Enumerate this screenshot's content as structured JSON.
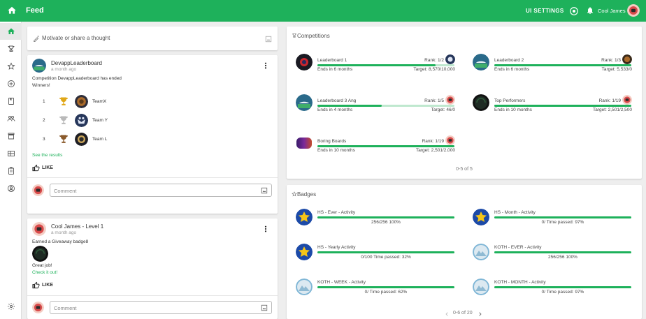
{
  "app": {
    "title": "Feed",
    "ui_settings": "UI SETTINGS",
    "user_name": "Cool James"
  },
  "colors": {
    "brand": "#1eb15b",
    "bar_track": "#bfe8cf"
  },
  "sidebar": {
    "icons": [
      "home-icon",
      "trophy-icon",
      "star-icon",
      "plus-circle-icon",
      "book-icon",
      "people-icon",
      "store-icon",
      "grid-icon",
      "assignment-icon",
      "account-icon",
      "settings-icon"
    ]
  },
  "composer": {
    "placeholder": "Motivate or share a thought"
  },
  "posts": [
    {
      "author": "DevappLeaderboard",
      "time": "a month ago",
      "text": "Competition DevappLeaderboard has ended",
      "text2": "Winners!",
      "winners": [
        {
          "place": "1",
          "team": "TeamX"
        },
        {
          "place": "2",
          "team": "Team Y"
        },
        {
          "place": "3",
          "team": "Team L"
        }
      ],
      "link": "See the results",
      "like": "LIKE",
      "comment_placeholder": "Comment"
    },
    {
      "author": "Cool James - Level 1",
      "time": "a month ago",
      "text": "Earned a Giveaway badge8",
      "text2": "Great job!",
      "link": "Check it out!",
      "like": "LIKE",
      "comment_placeholder": "Comment"
    }
  ],
  "competitions": {
    "title": "Competitions",
    "items": [
      {
        "name": "Leaderboard 1",
        "rank": "Rank: 1/2",
        "ends": "Ends in 6 months",
        "target": "Target: 8,570/10,000",
        "progress": 0.86
      },
      {
        "name": "Leaderboard 2",
        "rank": "Rank: 1/3",
        "ends": "Ends in 6 months",
        "target": "Target: 5,533/0",
        "progress": 1.0
      },
      {
        "name": "Leaderboard 3 Ang",
        "rank": "Rank: 1/5",
        "ends": "Ends in 4 months",
        "target": "Target: 46/0",
        "progress": 0.47
      },
      {
        "name": "Top Performers",
        "rank": "Rank: 1/19",
        "ends": "Ends in 10 months",
        "target": "Target: 2,501/2,500",
        "progress": 1.0
      },
      {
        "name": "Boring Boards",
        "rank": "Rank: 1/19",
        "ends": "Ends in 10 months",
        "target": "Target: 2,501/2,000",
        "progress": 1.0
      }
    ],
    "pagination": "0-5 of 5"
  },
  "badges": {
    "title": "Badges",
    "items": [
      {
        "name": "HS - Ever - Activity",
        "progress_text": "256/256 100%",
        "progress": 1.0,
        "icon": "star-blue"
      },
      {
        "name": "HS - Month - Activity",
        "progress_text": "0/ Time passed: 97%",
        "progress": 1.0,
        "icon": "star-blue"
      },
      {
        "name": "HS - Yearly Activity",
        "progress_text": "0/100 Time passed: 32%",
        "progress": 1.0,
        "icon": "star-blue"
      },
      {
        "name": "KOTH - EVER - Activity",
        "progress_text": "256/256 100%",
        "progress": 1.0,
        "icon": "mountain"
      },
      {
        "name": "KOTH - WEEK - Activity",
        "progress_text": "0/ Time passed: 62%",
        "progress": 1.0,
        "icon": "mountain"
      },
      {
        "name": "KOTH - MONTH - Activity",
        "progress_text": "0/ Time passed: 97%",
        "progress": 1.0,
        "icon": "mountain"
      }
    ],
    "pagination": "0-6 of 20"
  }
}
